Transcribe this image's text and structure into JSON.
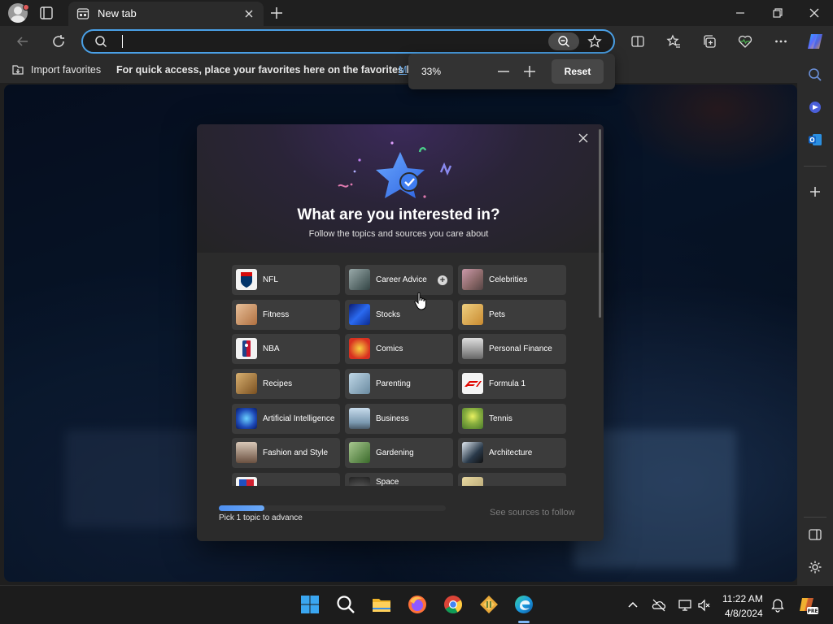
{
  "browser": {
    "tab": {
      "title": "New tab"
    },
    "address": {
      "value": "",
      "placeholder": ""
    },
    "favorites_bar": {
      "import_label": "Import favorites",
      "hint": "For quick access, place your favorites here on the favorites bar.",
      "hint_link": "M"
    },
    "zoom_popup": {
      "value": "33%",
      "reset_label": "Reset"
    }
  },
  "modal": {
    "title": "What are you interested in?",
    "subtitle": "Follow the topics and sources you care about",
    "topics": [
      {
        "label": "NFL",
        "icon": "nfl-logo",
        "color": "#013369"
      },
      {
        "label": "Career Advice",
        "icon": "career-photo",
        "color": "#5a6a6a",
        "hovered": true
      },
      {
        "label": "Celebrities",
        "icon": "celebrities-photo",
        "color": "#8a6a6a"
      },
      {
        "label": "Fitness",
        "icon": "fitness-photo",
        "color": "#c89060"
      },
      {
        "label": "Stocks",
        "icon": "stocks-photo",
        "color": "#1e3fa8"
      },
      {
        "label": "Pets",
        "icon": "pets-photo",
        "color": "#d8a040"
      },
      {
        "label": "NBA",
        "icon": "nba-logo",
        "color": "#1d428a"
      },
      {
        "label": "Comics",
        "icon": "comics-photo",
        "color": "#c8281e"
      },
      {
        "label": "Personal Finance",
        "icon": "finance-photo",
        "color": "#8a8a8a"
      },
      {
        "label": "Recipes",
        "icon": "recipes-photo",
        "color": "#a07840"
      },
      {
        "label": "Parenting",
        "icon": "parenting-photo",
        "color": "#6a8aa0"
      },
      {
        "label": "Formula 1",
        "icon": "f1-logo",
        "color": "#e10600"
      },
      {
        "label": "Artificial Intelligence",
        "icon": "ai-photo",
        "color": "#1e4ab8"
      },
      {
        "label": "Business",
        "icon": "business-photo",
        "color": "#7a98b0"
      },
      {
        "label": "Tennis",
        "icon": "tennis-photo",
        "color": "#6a9a3a"
      },
      {
        "label": "Fashion and Style",
        "icon": "fashion-photo",
        "color": "#6a5040"
      },
      {
        "label": "Gardening",
        "icon": "gardening-photo",
        "color": "#4a7a3a"
      },
      {
        "label": "Architecture",
        "icon": "architecture-photo",
        "color": "#2a3a4a"
      },
      {
        "label": "",
        "icon": "partial-logo",
        "color": "#2050c0"
      },
      {
        "label": "Space",
        "icon": "space-photo",
        "color": "#505050"
      },
      {
        "label": "",
        "icon": "partial-photo",
        "color": "#b0a070"
      }
    ],
    "progress": {
      "fraction": 0.2,
      "label": "Pick 1 topic to advance"
    },
    "next_label": "See sources to follow"
  },
  "taskbar": {
    "time": "11:22 AM",
    "date": "4/8/2024",
    "apps": [
      "windows-start",
      "search",
      "file-explorer",
      "firefox",
      "chrome",
      "sourcetree",
      "edge"
    ]
  },
  "colors": {
    "accent": "#4aa0e6",
    "progress": "#5b9cf3",
    "modal_bg": "#2b2b2b",
    "tile_bg": "#3c3c3c"
  }
}
